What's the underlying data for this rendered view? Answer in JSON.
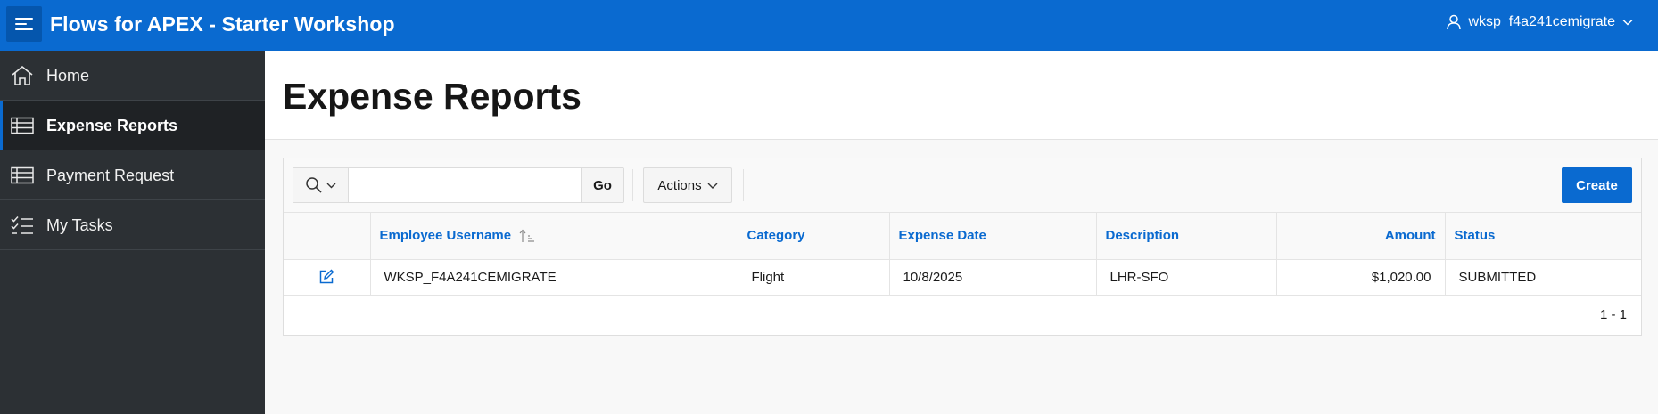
{
  "header": {
    "app_title": "Flows for APEX - Starter Workshop",
    "username": "wksp_f4a241cemigrate",
    "accent_color": "#0a6ad0"
  },
  "sidebar": {
    "items": [
      {
        "label": "Home",
        "icon": "home-icon",
        "active": false
      },
      {
        "label": "Expense Reports",
        "icon": "table-icon",
        "active": true
      },
      {
        "label": "Payment Request",
        "icon": "table-icon",
        "active": false
      },
      {
        "label": "My Tasks",
        "icon": "checklist-icon",
        "active": false
      }
    ]
  },
  "main": {
    "page_title": "Expense Reports",
    "toolbar": {
      "search_value": "",
      "go_label": "Go",
      "actions_label": "Actions",
      "create_label": "Create"
    },
    "table": {
      "columns": [
        "Employee Username",
        "Category",
        "Expense Date",
        "Description",
        "Amount",
        "Status"
      ],
      "rows": [
        {
          "username": "WKSP_F4A241CEMIGRATE",
          "category": "Flight",
          "date": "10/8/2025",
          "description": "LHR-SFO",
          "amount": "$1,020.00",
          "status": "SUBMITTED"
        }
      ],
      "pagination": "1 - 1"
    }
  }
}
